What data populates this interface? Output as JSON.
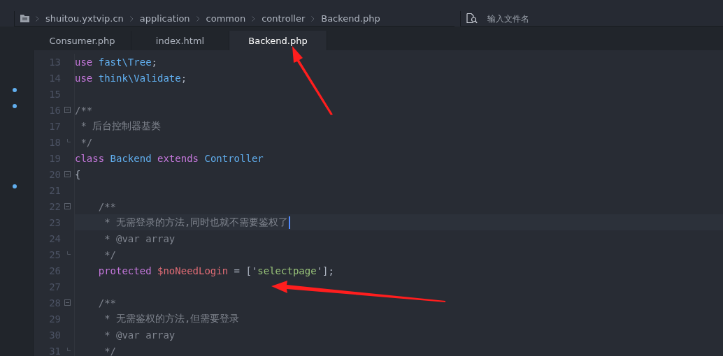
{
  "breadcrumb": {
    "items": [
      "shuitou.yxtvip.cn",
      "application",
      "common",
      "controller",
      "Backend.php"
    ]
  },
  "file_search": {
    "placeholder": "输入文件名"
  },
  "tabs": [
    {
      "label": "Consumer.php",
      "selected": false
    },
    {
      "label": "index.html",
      "selected": false
    },
    {
      "label": "Backend.php",
      "selected": true
    }
  ],
  "editor": {
    "lines": [
      {
        "number": "13",
        "marker": false,
        "kind": "plain",
        "current": false,
        "tokens": [
          {
            "kind": "keyword",
            "text": "use "
          },
          {
            "kind": "name",
            "text": "fast\\Tree"
          },
          {
            "kind": "plain",
            "text": ";"
          }
        ]
      },
      {
        "number": "14",
        "marker": false,
        "kind": "plain",
        "current": false,
        "tokens": [
          {
            "kind": "keyword",
            "text": "use "
          },
          {
            "kind": "name",
            "text": "think\\Validate"
          },
          {
            "kind": "plain",
            "text": ";"
          }
        ]
      },
      {
        "number": "15",
        "marker": true,
        "kind": "plain",
        "current": false
      },
      {
        "number": "16",
        "marker": true,
        "kind": "fold-start",
        "current": false,
        "tokens": [
          {
            "kind": "comment",
            "text": "/**"
          }
        ]
      },
      {
        "number": "17",
        "marker": false,
        "kind": "plain",
        "current": false,
        "tokens": [
          {
            "kind": "comment",
            "text": " * 后台控制器基类"
          }
        ]
      },
      {
        "number": "18",
        "marker": false,
        "kind": "fold-end",
        "current": false,
        "tokens": [
          {
            "kind": "comment",
            "text": " */"
          }
        ]
      },
      {
        "number": "19",
        "marker": false,
        "kind": "plain",
        "current": false,
        "tokens": [
          {
            "kind": "keyword",
            "text": "class "
          },
          {
            "kind": "name",
            "text": "Backend "
          },
          {
            "kind": "keyword",
            "text": "extends "
          },
          {
            "kind": "name",
            "text": "Controller"
          }
        ]
      },
      {
        "number": "20",
        "marker": false,
        "kind": "fold-start",
        "current": false,
        "tokens": [
          {
            "kind": "plain",
            "text": "{"
          }
        ]
      },
      {
        "number": "21",
        "marker": true,
        "kind": "plain",
        "current": false
      },
      {
        "number": "22",
        "marker": false,
        "kind": "fold-start",
        "current": false,
        "tokens": [
          {
            "kind": "comment",
            "text": "    /**"
          }
        ]
      },
      {
        "number": "23",
        "marker": false,
        "kind": "plain",
        "current": true,
        "tokens": [
          {
            "kind": "comment",
            "text": "     * 无需登录的方法,同时也就不需要鉴权了"
          }
        ]
      },
      {
        "number": "24",
        "marker": false,
        "kind": "plain",
        "current": false,
        "tokens": [
          {
            "kind": "comment",
            "text": "     * @var array"
          }
        ]
      },
      {
        "number": "25",
        "marker": false,
        "kind": "fold-end",
        "current": false,
        "tokens": [
          {
            "kind": "comment",
            "text": "     */"
          }
        ]
      },
      {
        "number": "26",
        "marker": false,
        "kind": "plain",
        "current": false,
        "tokens": [
          {
            "kind": "keyword",
            "text": "    protected "
          },
          {
            "kind": "variable",
            "text": "$noNeedLogin"
          },
          {
            "kind": "plain",
            "text": " = ['"
          },
          {
            "kind": "string",
            "text": "selectpage"
          },
          {
            "kind": "plain",
            "text": "'];"
          }
        ]
      },
      {
        "number": "27",
        "marker": false,
        "kind": "plain",
        "current": false
      },
      {
        "number": "28",
        "marker": false,
        "kind": "fold-start",
        "current": false,
        "tokens": [
          {
            "kind": "comment",
            "text": "    /**"
          }
        ]
      },
      {
        "number": "29",
        "marker": false,
        "kind": "plain",
        "current": false,
        "tokens": [
          {
            "kind": "comment",
            "text": "     * 无需鉴权的方法,但需要登录"
          }
        ]
      },
      {
        "number": "30",
        "marker": false,
        "kind": "plain",
        "current": false,
        "tokens": [
          {
            "kind": "comment",
            "text": "     * @var array"
          }
        ]
      },
      {
        "number": "31",
        "marker": false,
        "kind": "fold-end",
        "current": false,
        "tokens": [
          {
            "kind": "comment",
            "text": "     */"
          }
        ]
      }
    ]
  }
}
